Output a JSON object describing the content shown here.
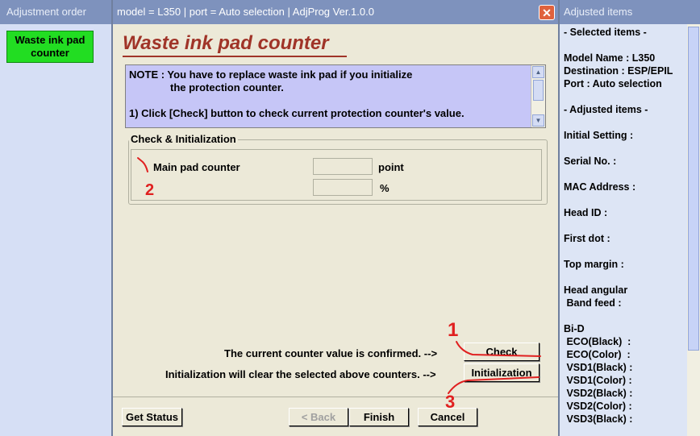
{
  "left_panel": {
    "title": "Adjustment order",
    "selected_item": "Waste ink pad counter"
  },
  "window": {
    "title": "model = L350 | port = Auto selection | AdjProg Ver.1.0.0",
    "close_glyph": "✕"
  },
  "heading": "Waste ink pad counter",
  "note": {
    "line1": "NOTE : You have to replace waste ink pad if you initialize",
    "line2": "the protection counter.",
    "line3": "1) Click [Check] button to check current protection counter's value."
  },
  "group": {
    "label": "Check & Initialization",
    "row1_label": "Main pad counter",
    "row1_value": "",
    "row1_unit": "point",
    "row2_value": "",
    "row2_unit": "%"
  },
  "actions": {
    "confirm_text": "The current counter value is confirmed. -->",
    "check_label": "Check",
    "init_text": "Initialization will clear the selected above counters. -->",
    "init_label": "Initialization"
  },
  "footer": {
    "get_status": "Get Status",
    "back": "< Back",
    "finish": "Finish",
    "cancel": "Cancel"
  },
  "right_panel": {
    "title": "Adjusted items",
    "lines": [
      "- Selected items -",
      "",
      "Model Name : L350",
      "Destination : ESP/EPIL",
      "Port : Auto selection",
      "",
      "- Adjusted items -",
      "",
      "Initial Setting :",
      "",
      "Serial No. :",
      "",
      "MAC Address :",
      "",
      "Head ID :",
      "",
      "First dot :",
      "",
      "Top margin :",
      "",
      "Head angular",
      " Band feed :",
      "",
      "Bi-D",
      " ECO(Black)  :",
      " ECO(Color)  :",
      " VSD1(Black) :",
      " VSD1(Color) :",
      " VSD2(Black) :",
      " VSD2(Color) :",
      " VSD3(Black) :"
    ]
  },
  "annotations": {
    "n1": "1",
    "n2": "2",
    "n3": "3",
    "color": "#e02020"
  },
  "colors": {
    "title_bar": "#7e92bd",
    "heading": "#a03428",
    "note_bg": "#c6c6f7",
    "selected_item": "#22dd22",
    "window_bg": "#ece9d8"
  }
}
